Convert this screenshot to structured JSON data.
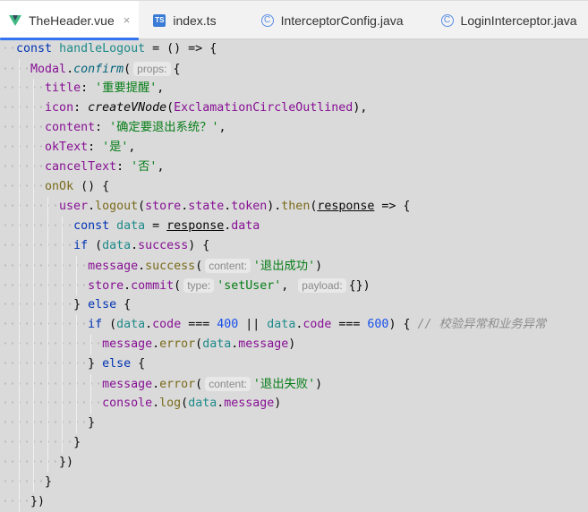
{
  "tabs": [
    {
      "label": "TheHeader.vue",
      "icon": "vue-icon",
      "active": true,
      "closable": true
    },
    {
      "label": "index.ts",
      "icon": "typescript-icon",
      "active": false
    },
    {
      "label": "InterceptorConfig.java",
      "icon": "java-class-icon",
      "active": false
    },
    {
      "label": "LoginInterceptor.java",
      "icon": "java-class-icon",
      "active": false
    }
  ],
  "icon_glyphs": {
    "ts": "TS",
    "cls": "C",
    "close": "×"
  },
  "colors": {
    "keyword": "#0033b3",
    "property": "#871094",
    "string": "#067d17",
    "number": "#1750eb",
    "active_tab_underline": "#3574f0"
  },
  "code_lines": [
    {
      "indent": 0,
      "tokens": [
        [
          "kw",
          "const "
        ],
        [
          "var",
          "handleLogout"
        ],
        [
          "p",
          " = () => {"
        ]
      ]
    },
    {
      "indent": 1,
      "tokens": [
        [
          "prop",
          "Modal"
        ],
        [
          "p",
          "."
        ],
        [
          "it",
          "confirm"
        ],
        [
          "p",
          "("
        ],
        [
          "hint",
          "props:"
        ],
        [
          "p",
          "{"
        ]
      ]
    },
    {
      "indent": 2,
      "tokens": [
        [
          "prop",
          "title"
        ],
        [
          "p",
          ": "
        ],
        [
          "str",
          "'重要提醒'"
        ],
        [
          "p",
          ","
        ]
      ]
    },
    {
      "indent": 2,
      "tokens": [
        [
          "prop",
          "icon"
        ],
        [
          "p",
          ": "
        ],
        [
          "it2",
          "createVNode"
        ],
        [
          "p",
          "("
        ],
        [
          "prop",
          "ExclamationCircleOutlined"
        ],
        [
          "p",
          "),"
        ]
      ]
    },
    {
      "indent": 2,
      "tokens": [
        [
          "prop",
          "content"
        ],
        [
          "p",
          ": "
        ],
        [
          "str",
          "'确定要退出系统？'"
        ],
        [
          "p",
          ","
        ]
      ]
    },
    {
      "indent": 2,
      "tokens": [
        [
          "prop",
          "okText"
        ],
        [
          "p",
          ": "
        ],
        [
          "str",
          "'是'"
        ],
        [
          "p",
          ","
        ]
      ]
    },
    {
      "indent": 2,
      "tokens": [
        [
          "prop",
          "cancelText"
        ],
        [
          "p",
          ": "
        ],
        [
          "str",
          "'否'"
        ],
        [
          "p",
          ","
        ]
      ]
    },
    {
      "indent": 2,
      "tokens": [
        [
          "method",
          "onOk"
        ],
        [
          "p",
          " () {"
        ]
      ]
    },
    {
      "indent": 3,
      "tokens": [
        [
          "prop",
          "user"
        ],
        [
          "p",
          "."
        ],
        [
          "method",
          "logout"
        ],
        [
          "p",
          "("
        ],
        [
          "prop",
          "store"
        ],
        [
          "p",
          "."
        ],
        [
          "prop",
          "state"
        ],
        [
          "p",
          "."
        ],
        [
          "prop",
          "token"
        ],
        [
          "p",
          ")."
        ],
        [
          "method",
          "then"
        ],
        [
          "p",
          "("
        ],
        [
          "ul",
          "response"
        ],
        [
          "p",
          " => {"
        ]
      ]
    },
    {
      "indent": 4,
      "tokens": [
        [
          "kw",
          "const "
        ],
        [
          "var",
          "data"
        ],
        [
          "p",
          " = "
        ],
        [
          "ul",
          "response"
        ],
        [
          "p",
          "."
        ],
        [
          "prop",
          "data"
        ]
      ]
    },
    {
      "indent": 4,
      "tokens": [
        [
          "kw",
          "if "
        ],
        [
          "p",
          "("
        ],
        [
          "var",
          "data"
        ],
        [
          "p",
          "."
        ],
        [
          "prop",
          "success"
        ],
        [
          "p",
          ") {"
        ]
      ]
    },
    {
      "indent": 5,
      "tokens": [
        [
          "prop",
          "message"
        ],
        [
          "p",
          "."
        ],
        [
          "method",
          "success"
        ],
        [
          "p",
          "("
        ],
        [
          "hint",
          "content:"
        ],
        [
          "str",
          "'退出成功'"
        ],
        [
          "p",
          ")"
        ]
      ]
    },
    {
      "indent": 5,
      "tokens": [
        [
          "prop",
          "store"
        ],
        [
          "p",
          "."
        ],
        [
          "prop",
          "commit"
        ],
        [
          "p",
          "("
        ],
        [
          "hint",
          "type:"
        ],
        [
          "str",
          "'setUser'"
        ],
        [
          "p",
          ", "
        ],
        [
          "hint",
          "payload:"
        ],
        [
          "p",
          "{})"
        ]
      ]
    },
    {
      "indent": 4,
      "tokens": [
        [
          "p",
          "} "
        ],
        [
          "kw",
          "else"
        ],
        [
          "p",
          " {"
        ]
      ]
    },
    {
      "indent": 5,
      "tokens": [
        [
          "kw",
          "if "
        ],
        [
          "p",
          "("
        ],
        [
          "var",
          "data"
        ],
        [
          "p",
          "."
        ],
        [
          "prop",
          "code"
        ],
        [
          "p",
          " === "
        ],
        [
          "num",
          "400"
        ],
        [
          "p",
          " || "
        ],
        [
          "var",
          "data"
        ],
        [
          "p",
          "."
        ],
        [
          "prop",
          "code"
        ],
        [
          "p",
          " === "
        ],
        [
          "num",
          "600"
        ],
        [
          "p",
          ") { "
        ],
        [
          "cmt",
          "// 校验异常和业务异常"
        ]
      ]
    },
    {
      "indent": 6,
      "tokens": [
        [
          "prop",
          "message"
        ],
        [
          "p",
          "."
        ],
        [
          "method",
          "error"
        ],
        [
          "p",
          "("
        ],
        [
          "var",
          "data"
        ],
        [
          "p",
          "."
        ],
        [
          "prop",
          "message"
        ],
        [
          "p",
          ")"
        ]
      ]
    },
    {
      "indent": 5,
      "tokens": [
        [
          "p",
          "} "
        ],
        [
          "kw",
          "else"
        ],
        [
          "p",
          " {"
        ]
      ]
    },
    {
      "indent": 6,
      "tokens": [
        [
          "prop",
          "message"
        ],
        [
          "p",
          "."
        ],
        [
          "method",
          "error"
        ],
        [
          "p",
          "("
        ],
        [
          "hint",
          "content:"
        ],
        [
          "str",
          "'退出失败'"
        ],
        [
          "p",
          ")"
        ]
      ]
    },
    {
      "indent": 6,
      "tokens": [
        [
          "prop",
          "console"
        ],
        [
          "p",
          "."
        ],
        [
          "method",
          "log"
        ],
        [
          "p",
          "("
        ],
        [
          "var",
          "data"
        ],
        [
          "p",
          "."
        ],
        [
          "prop",
          "message"
        ],
        [
          "p",
          ")"
        ]
      ]
    },
    {
      "indent": 5,
      "tokens": [
        [
          "p",
          "}"
        ]
      ]
    },
    {
      "indent": 4,
      "tokens": [
        [
          "p",
          "}"
        ]
      ]
    },
    {
      "indent": 3,
      "tokens": [
        [
          "p",
          "})"
        ]
      ]
    },
    {
      "indent": 2,
      "tokens": [
        [
          "p",
          "}"
        ]
      ]
    },
    {
      "indent": 1,
      "tokens": [
        [
          "p",
          "})"
        ]
      ]
    }
  ]
}
